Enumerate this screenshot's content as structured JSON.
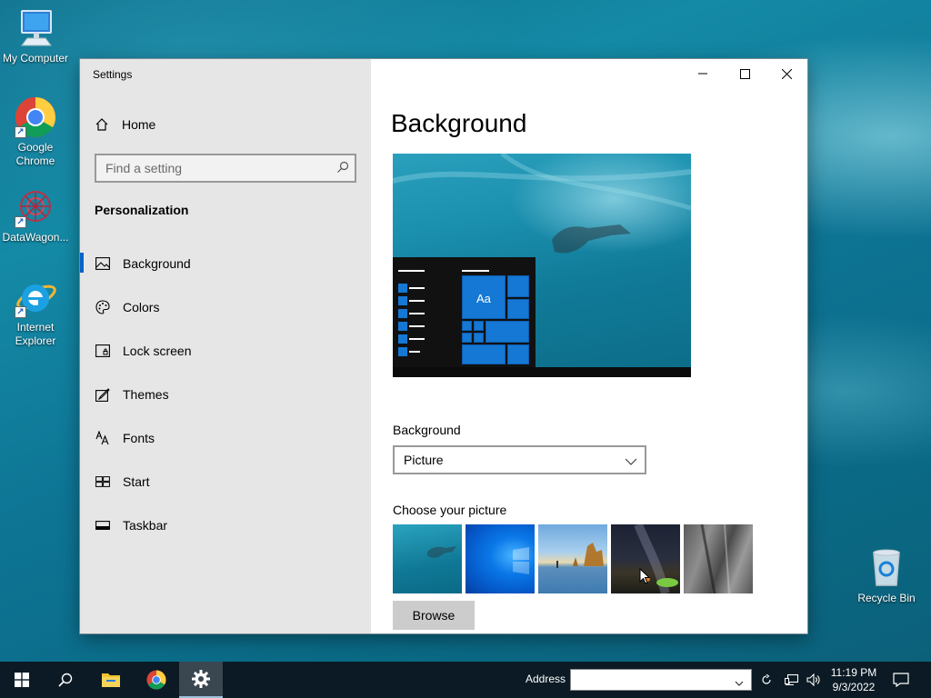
{
  "desktop": {
    "icons": [
      {
        "label": "My Computer"
      },
      {
        "label": "Google Chrome"
      },
      {
        "label": "DataWagon..."
      },
      {
        "label": "Internet Explorer"
      },
      {
        "label": "Recycle Bin"
      }
    ]
  },
  "window": {
    "title": "Settings",
    "home_label": "Home",
    "search_placeholder": "Find a setting",
    "section": "Personalization",
    "nav": [
      {
        "label": "Background",
        "icon": "picture-icon",
        "active": true
      },
      {
        "label": "Colors",
        "icon": "palette-icon"
      },
      {
        "label": "Lock screen",
        "icon": "lock-screen-icon"
      },
      {
        "label": "Themes",
        "icon": "themes-icon"
      },
      {
        "label": "Fonts",
        "icon": "fonts-icon"
      },
      {
        "label": "Start",
        "icon": "start-icon"
      },
      {
        "label": "Taskbar",
        "icon": "taskbar-icon"
      }
    ],
    "page_title": "Background",
    "preview_tile_text": "Aa",
    "background_label": "Background",
    "background_value": "Picture",
    "choose_label": "Choose your picture",
    "browse_label": "Browse",
    "accent": "#0a63c9"
  },
  "taskbar": {
    "address_label": "Address",
    "address_value": "",
    "time": "11:19 PM",
    "date": "9/3/2022"
  }
}
